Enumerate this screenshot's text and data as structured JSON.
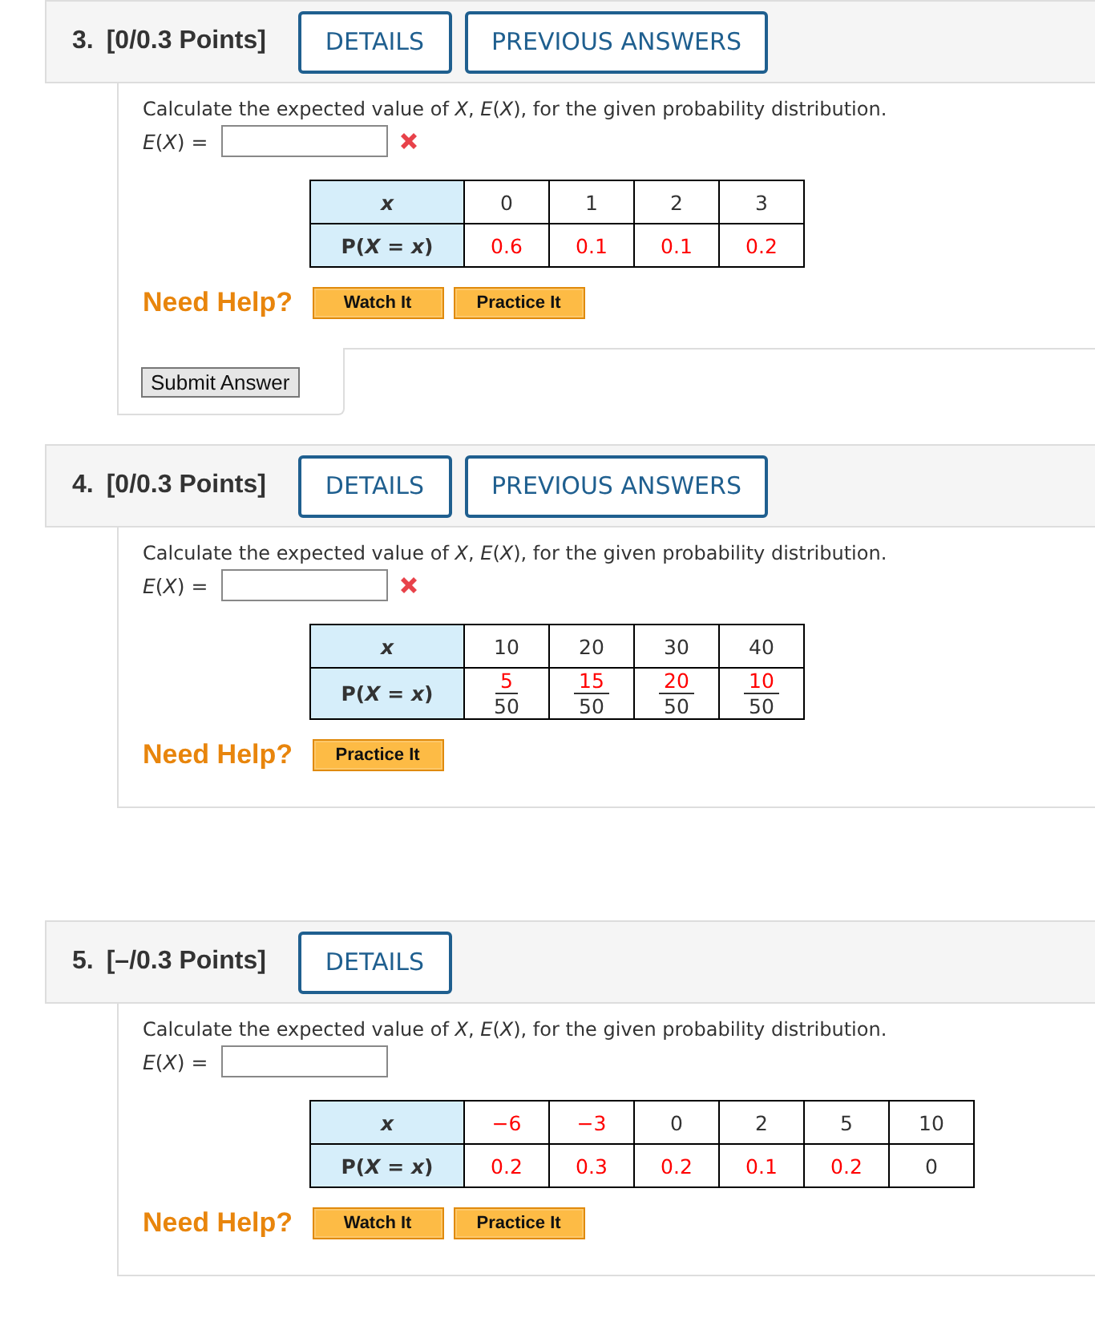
{
  "questions": [
    {
      "number": "3.",
      "points": "[0/0.3 Points]",
      "header_buttons": [
        "DETAILS",
        "PREVIOUS ANSWERS"
      ],
      "prompt": "Calculate the expected value of *X*, *E*(*X*), for the given probability distribution.",
      "answer_label": "*E*(*X*) =",
      "incorrect": true,
      "row_headers": [
        "x",
        "P(*X* = *x*)"
      ],
      "rows": [
        [
          {
            "kind": "plain",
            "text": "0",
            "color": "#333333"
          },
          {
            "kind": "plain",
            "text": "1",
            "color": "#333333"
          },
          {
            "kind": "plain",
            "text": "2",
            "color": "#333333"
          },
          {
            "kind": "plain",
            "text": "3",
            "color": "#333333"
          }
        ],
        [
          {
            "kind": "plain",
            "text": "0.6",
            "color": "#ff0000"
          },
          {
            "kind": "plain",
            "text": "0.1",
            "color": "#ff0000"
          },
          {
            "kind": "plain",
            "text": "0.1",
            "color": "#ff0000"
          },
          {
            "kind": "plain",
            "text": "0.2",
            "color": "#ff0000"
          }
        ]
      ],
      "help_label": "Need Help?",
      "help_buttons": [
        "Watch It",
        "Practice It"
      ],
      "submit_button": "Submit Answer"
    },
    {
      "number": "4.",
      "points": "[0/0.3 Points]",
      "header_buttons": [
        "DETAILS",
        "PREVIOUS ANSWERS"
      ],
      "prompt": "Calculate the expected value of *X*, *E*(*X*), for the given probability distribution.",
      "answer_label": "*E*(*X*) =",
      "incorrect": true,
      "row_headers": [
        "x",
        "P(*X* = *x*)"
      ],
      "rows": [
        [
          {
            "kind": "plain",
            "text": "10",
            "color": "#333333"
          },
          {
            "kind": "plain",
            "text": "20",
            "color": "#333333"
          },
          {
            "kind": "plain",
            "text": "30",
            "color": "#333333"
          },
          {
            "kind": "plain",
            "text": "40",
            "color": "#333333"
          }
        ],
        [
          {
            "kind": "fraction",
            "numerator": "5",
            "denominator": "50",
            "color": "#ff0000"
          },
          {
            "kind": "fraction",
            "numerator": "15",
            "denominator": "50",
            "color": "#ff0000"
          },
          {
            "kind": "fraction",
            "numerator": "20",
            "denominator": "50",
            "color": "#ff0000"
          },
          {
            "kind": "fraction",
            "numerator": "10",
            "denominator": "50",
            "color": "#ff0000"
          }
        ]
      ],
      "help_label": "Need Help?",
      "help_buttons": [
        "Practice It"
      ]
    },
    {
      "number": "5.",
      "points": "[–/0.3 Points]",
      "header_buttons": [
        "DETAILS"
      ],
      "prompt": "Calculate the expected value of *X*, *E*(*X*), for the given probability distribution.",
      "answer_label": "*E*(*X*) =",
      "incorrect": false,
      "row_headers": [
        "x",
        "P(*X* = *x*)"
      ],
      "rows": [
        [
          {
            "kind": "plain",
            "text": "−6",
            "color": "#ff0000"
          },
          {
            "kind": "plain",
            "text": "−3",
            "color": "#ff0000"
          },
          {
            "kind": "plain",
            "text": "0",
            "color": "#333333"
          },
          {
            "kind": "plain",
            "text": "2",
            "color": "#333333"
          },
          {
            "kind": "plain",
            "text": "5",
            "color": "#333333"
          },
          {
            "kind": "plain",
            "text": "10",
            "color": "#333333"
          }
        ],
        [
          {
            "kind": "plain",
            "text": "0.2",
            "color": "#ff0000"
          },
          {
            "kind": "plain",
            "text": "0.3",
            "color": "#ff0000"
          },
          {
            "kind": "plain",
            "text": "0.2",
            "color": "#ff0000"
          },
          {
            "kind": "plain",
            "text": "0.1",
            "color": "#ff0000"
          },
          {
            "kind": "plain",
            "text": "0.2",
            "color": "#ff0000"
          },
          {
            "kind": "plain",
            "text": "0",
            "color": "#333333"
          }
        ]
      ],
      "help_label": "Need Help?",
      "help_buttons": [
        "Watch It",
        "Practice It"
      ]
    }
  ]
}
